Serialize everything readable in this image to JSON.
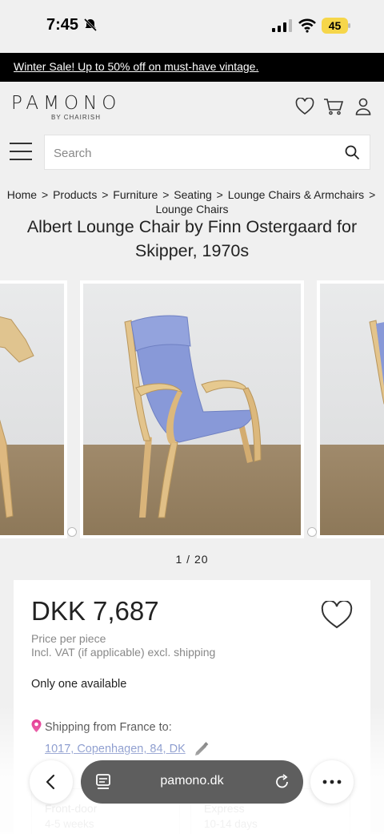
{
  "status_bar": {
    "time": "7:45",
    "battery": "45"
  },
  "promo": {
    "text": "Winter Sale! Up to 50% off on must-have vintage."
  },
  "header": {
    "logo": "PAMONO",
    "logo_sub": "BY CHAIRISH"
  },
  "search": {
    "placeholder": "Search"
  },
  "breadcrumb": {
    "items": [
      "Home",
      "Products",
      "Furniture",
      "Seating",
      "Lounge Chairs & Armchairs",
      "Lounge Chairs"
    ],
    "separator": ">"
  },
  "product": {
    "title": "Albert Lounge Chair by Finn Ostergaard for Skipper, 1970s",
    "image_counter": "1 / 20",
    "price": "DKK 7,687",
    "price_per": "Price per piece",
    "vat_note": "Incl. VAT (if applicable) excl. shipping",
    "availability": "Only one available",
    "shipping_from": "Shipping from France to:",
    "address": "1017, Copenhagen, 84, DK"
  },
  "shipping_options": [
    {
      "label": "Front-door",
      "time": "4-5 weeks"
    },
    {
      "label": "Express",
      "time": "10-14 days"
    }
  ],
  "browser": {
    "url": "pamono.dk"
  },
  "colors": {
    "promo_bg": "#000000",
    "address_link": "#1a3a9e",
    "pin": "#e0157f",
    "url_pill": "#5e5e5e"
  }
}
